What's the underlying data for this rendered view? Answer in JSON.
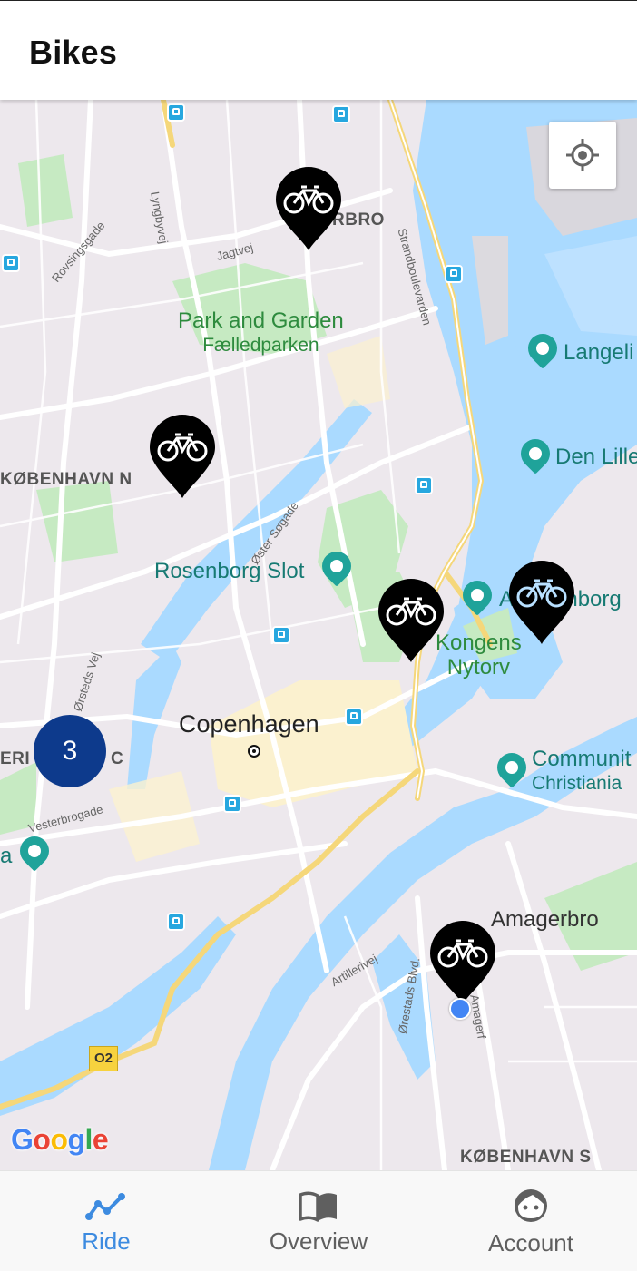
{
  "app_bar": {
    "title": "Bikes"
  },
  "map": {
    "labels": {
      "park_line1": "Park and Garden",
      "park_line2": "Fælledparken",
      "langelinie": "Langeli",
      "den_lille": "Den Lille",
      "kobenhavn_n": "KØBENHAVN N",
      "rosenborg": "Rosenborg Slot",
      "amalienborg": "Amalienborg",
      "kongens_line1": "Kongens",
      "kongens_line2": "Nytorv",
      "copenhagen": "Copenhagen",
      "community_line1": "Communit",
      "community_line2": "Christiania",
      "vesterbro_partial": "ERI",
      "c_partial": "C",
      "a_partial": "a",
      "amagerbro": "Amagerbro",
      "kobenhavn_s": "KØBENHAVN S",
      "nbro": "RBRO"
    },
    "streets": {
      "lyngbyvej": "Lyngbyvej",
      "jagtvej": "Jagtvej",
      "rovsingsgade": "Rovsingsgade",
      "strandboulevarden": "Strandboulevarden",
      "oster_sogade": "Øster Søgade",
      "h_c_orsteds_vej": "H. C. Ørsteds Vej",
      "vesterbrogade": "Vesterbrogade",
      "artillerivej": "Artillerivej",
      "orestads_blvd": "Ørestads Blvd.",
      "amagerfaelledvej": "Amagerf"
    },
    "route_badge": "O2",
    "cluster_count": "3",
    "google_logo": [
      "G",
      "o",
      "o",
      "g",
      "l",
      "e"
    ],
    "icons": {
      "locate": "my-location-icon",
      "marker": "bike-marker-icon"
    }
  },
  "bottom_nav": {
    "items": [
      {
        "label": "Ride",
        "icon": "ride-graph-icon",
        "active": true
      },
      {
        "label": "Overview",
        "icon": "book-icon",
        "active": false
      },
      {
        "label": "Account",
        "icon": "face-icon",
        "active": false
      }
    ],
    "active_color": "#3d8be0",
    "inactive_color": "#5f5f5f"
  }
}
